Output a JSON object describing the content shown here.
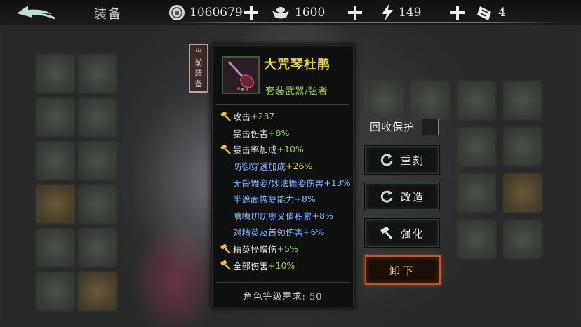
{
  "header": {
    "page_title": "装备",
    "resources": [
      {
        "icon": "coin-icon",
        "value": "1060679"
      },
      {
        "icon": "ingot-icon",
        "value": "1600"
      },
      {
        "icon": "lightning-icon",
        "value": "149"
      },
      {
        "icon": "ticket-icon",
        "value": "4"
      }
    ]
  },
  "equipped_tag": "当前装备",
  "item": {
    "name": "大咒琴杜鹃",
    "type": "套装武器/弦者",
    "stats": [
      {
        "label": "攻击",
        "value": "+237",
        "hammer": true,
        "style": "white"
      },
      {
        "label": "暴击伤害",
        "value": "+8%",
        "hammer": false,
        "style": "white"
      },
      {
        "label": "暴击率加成",
        "value": "+10%",
        "hammer": true,
        "style": "white"
      },
      {
        "label": "防御穿透加成",
        "value": "+26%",
        "hammer": false,
        "style": "blue-yellow"
      },
      {
        "label": "无骨舞姿/妙法舞姿伤害",
        "value": "+13%",
        "hammer": false,
        "style": "blue"
      },
      {
        "label": "半遮面恢复能力",
        "value": "+8%",
        "hammer": false,
        "style": "blue"
      },
      {
        "label": "嘈嘈切切奥义值积累",
        "value": "+8%",
        "hammer": false,
        "style": "blue"
      },
      {
        "label": "对精英及首领伤害",
        "value": "+6%",
        "hammer": false,
        "style": "blue"
      },
      {
        "label": "精英怪增伤",
        "value": "+5%",
        "hammer": true,
        "style": "white"
      },
      {
        "label": "全部伤害",
        "value": "+10%",
        "hammer": true,
        "style": "white"
      }
    ],
    "level_requirement": "角色等级需求: 50"
  },
  "actions": {
    "recycle_protect_label": "回收保护",
    "reforge_label": "重刻",
    "modify_label": "改造",
    "enhance_label": "强化",
    "unequip_label": "卸下"
  },
  "colors": {
    "item_name": "#ecd83a",
    "stat_green": "#9bd24a",
    "stat_blue": "#8fb4ff",
    "unequip_border": "#c7552a"
  }
}
